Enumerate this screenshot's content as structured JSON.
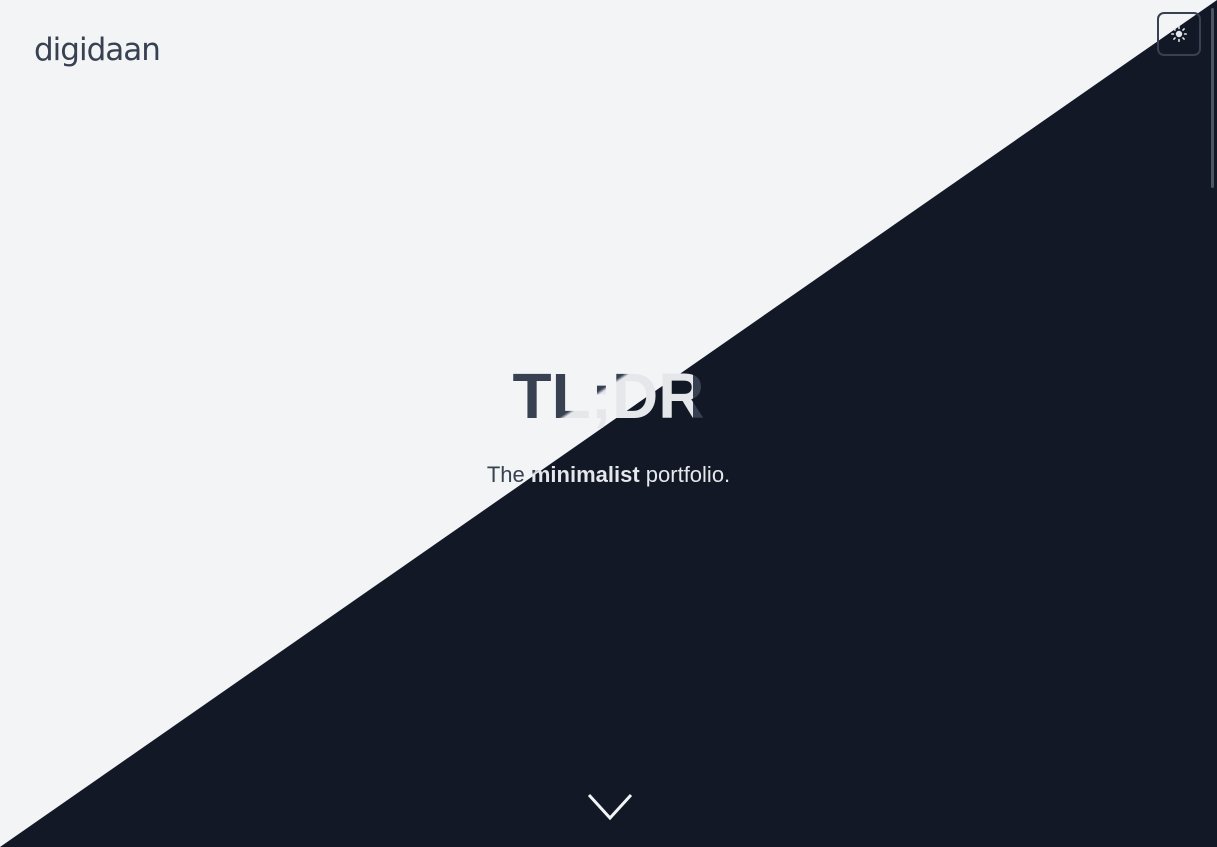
{
  "header": {
    "logo_text": "digidaan",
    "theme_toggle_icon": "sun-icon"
  },
  "hero": {
    "title": "TL;DR",
    "subtitle_pre": "The ",
    "subtitle_bold": "minimalist",
    "subtitle_post": " portfolio."
  },
  "scroll_indicator": {
    "icon": "chevron-down-icon"
  },
  "colors": {
    "light_bg": "#f3f4f6",
    "dark_bg": "#121826",
    "text_dark": "#374151",
    "text_light": "#e5e7eb"
  }
}
